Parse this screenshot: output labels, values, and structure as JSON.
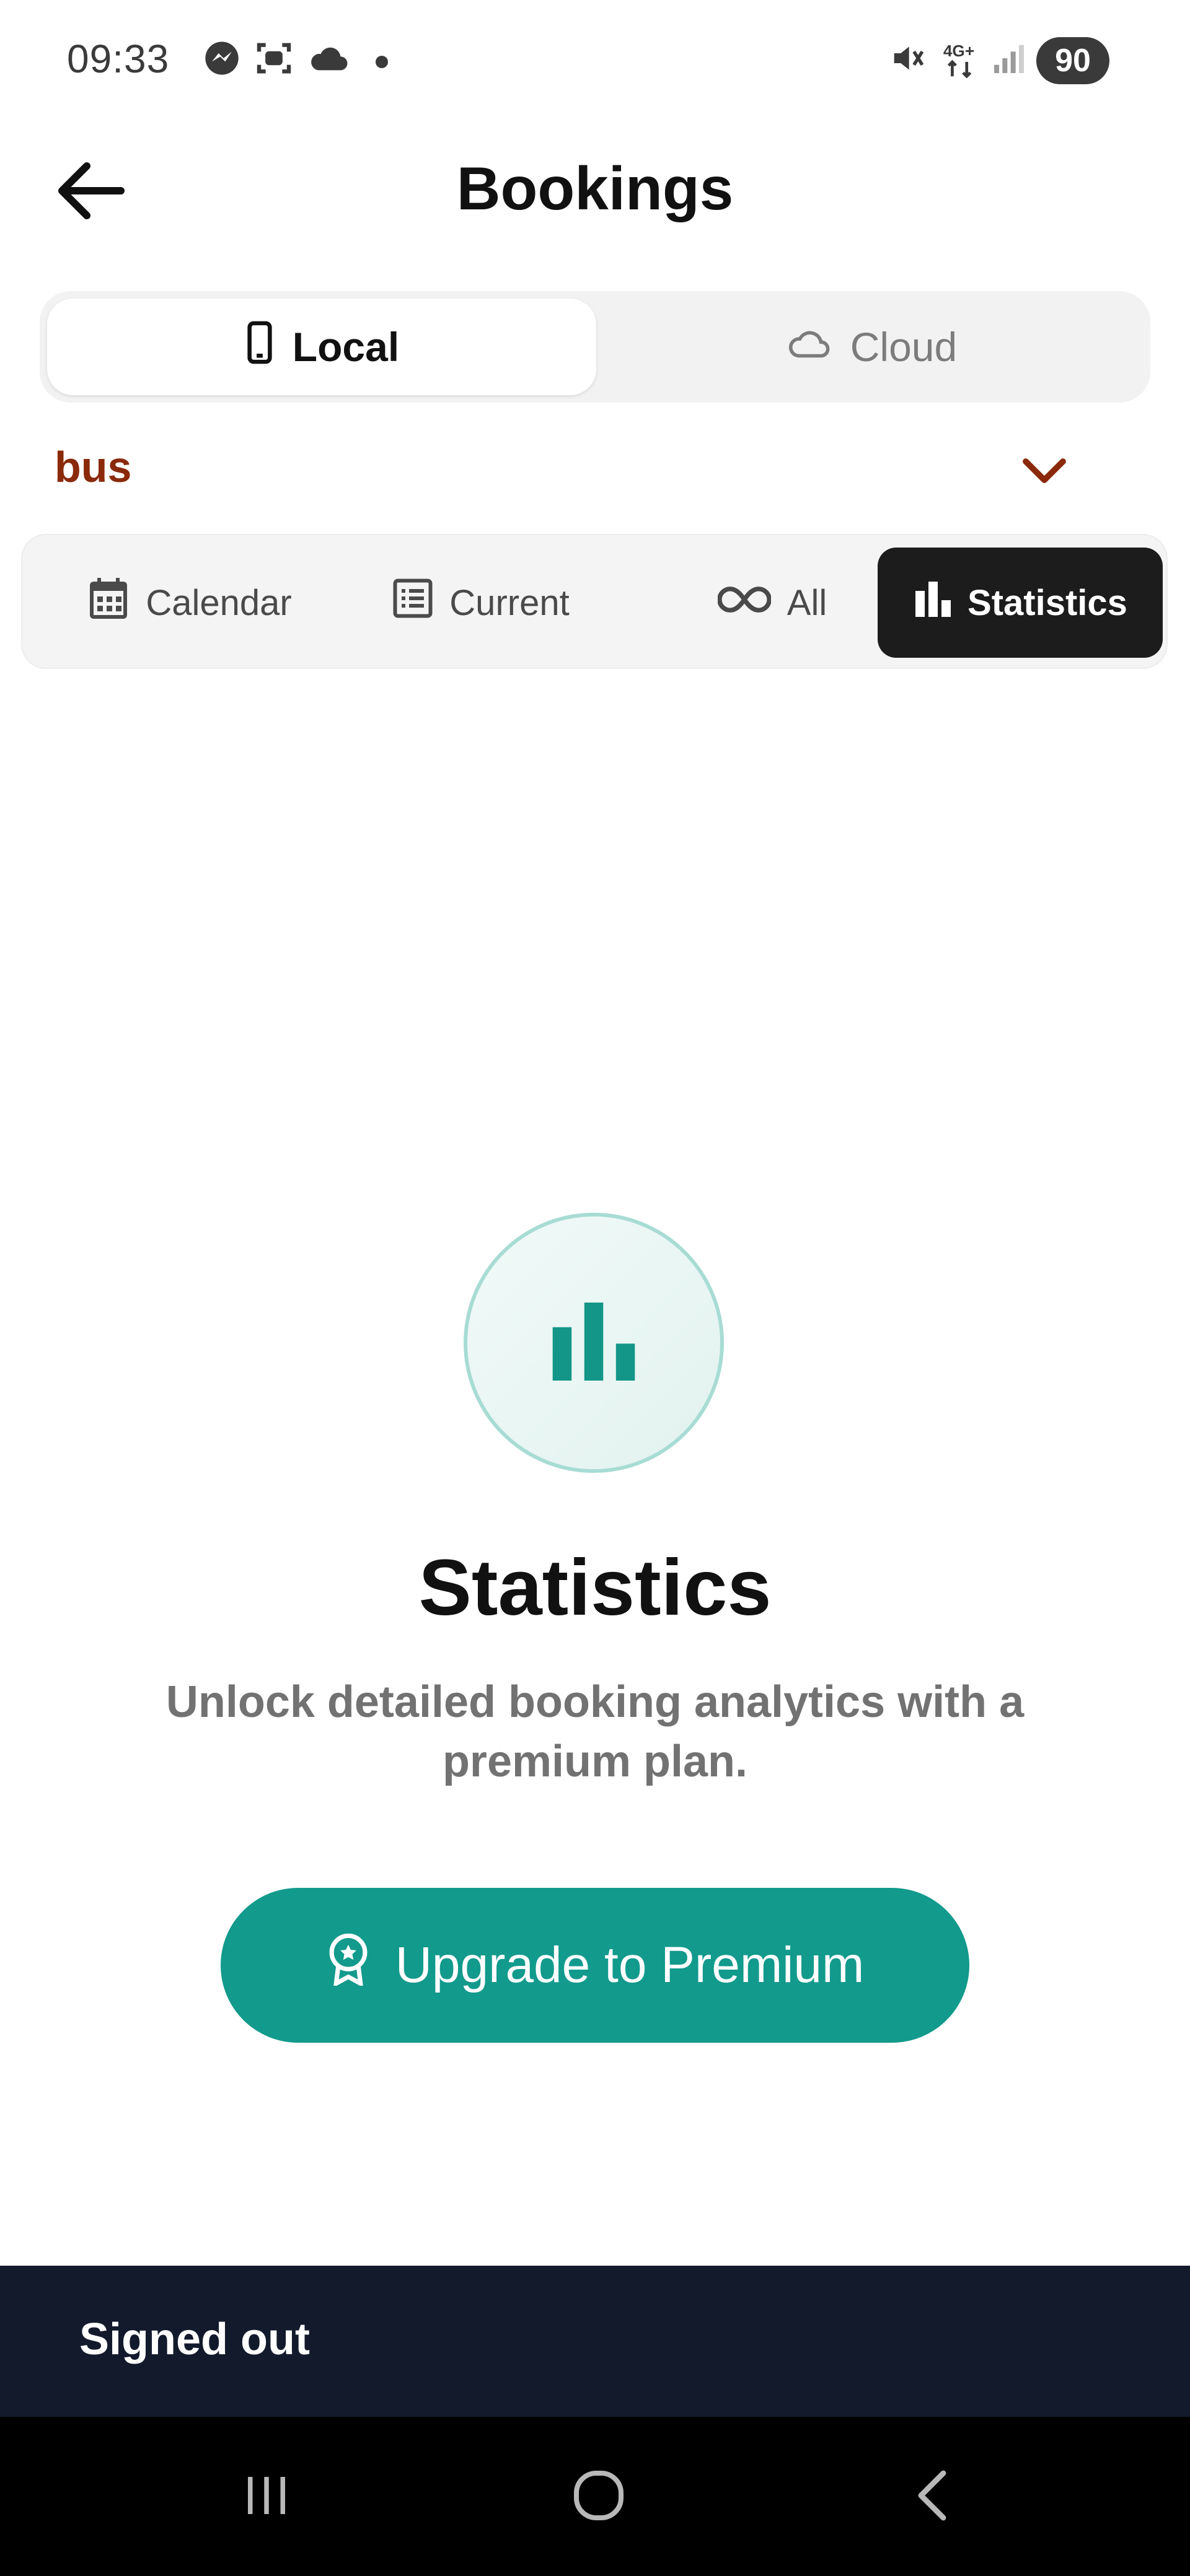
{
  "status_bar": {
    "time": "09:33",
    "battery": "90",
    "icons": [
      "messenger-icon",
      "screenshot-icon",
      "cloud-icon",
      "mute-icon",
      "network-4g-icon",
      "signal-icon"
    ]
  },
  "header": {
    "title": "Bookings",
    "back_icon": "arrow-left-icon"
  },
  "storage_toggle": {
    "local_label": "Local",
    "cloud_label": "Cloud",
    "selected": "Local"
  },
  "selector": {
    "value": "bus"
  },
  "tabs": [
    {
      "label": "Calendar",
      "icon": "calendar-icon"
    },
    {
      "label": "Current",
      "icon": "list-icon"
    },
    {
      "label": "All",
      "icon": "infinity-icon"
    },
    {
      "label": "Statistics",
      "icon": "bar-chart-icon",
      "active": true
    }
  ],
  "empty_state": {
    "title": "Statistics",
    "subtitle": "Unlock detailed booking analytics with a premium plan.",
    "button_label": "Upgrade to Premium"
  },
  "snackbar": {
    "message": "Signed out"
  },
  "colors": {
    "accent": "#129a8c",
    "dropdown_text": "#8a2a0a",
    "active_tab_bg": "#1c1c1c",
    "snackbar_bg": "#131a2c"
  }
}
